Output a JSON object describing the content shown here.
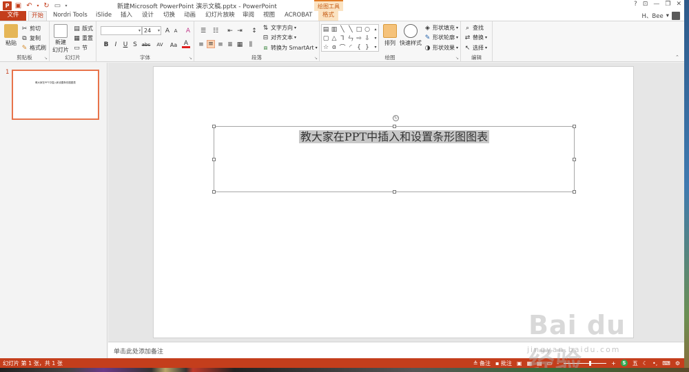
{
  "window": {
    "title": "新建Microsoft PowerPoint 演示文稿.pptx - PowerPoint",
    "contextual_group": "绘图工具",
    "help": "?",
    "minimize": "—",
    "restore": "❐",
    "close": "✕"
  },
  "qat": {
    "logo": "P"
  },
  "tabs": {
    "file": "文件",
    "items": [
      "开始",
      "Nordri Tools",
      "iSlide",
      "插入",
      "设计",
      "切换",
      "动画",
      "幻灯片放映",
      "审阅",
      "视图",
      "ACROBAT"
    ],
    "format": "格式",
    "active_index": 0
  },
  "user": {
    "name": "H、Bee",
    "dropdown": "▾"
  },
  "ribbon": {
    "clipboard": {
      "paste": "粘贴",
      "cut": "剪切",
      "copy": "复制",
      "format_painter": "格式刷",
      "label": "剪贴板"
    },
    "slides": {
      "new_slide": "新建",
      "new_slide2": "幻灯片",
      "layout": "版式",
      "reset": "重置",
      "section": "节",
      "label": "幻灯片"
    },
    "font": {
      "name": "",
      "size": "24",
      "grow": "A",
      "shrink": "A",
      "clear": "A",
      "bold": "B",
      "italic": "I",
      "underline": "U",
      "shadow": "S",
      "strike": "abc",
      "spacing": "AV",
      "case": "Aa",
      "color": "A",
      "label": "字体"
    },
    "paragraph": {
      "text_direction": "文字方向",
      "align_text": "对齐文本",
      "smartart": "转换为 SmartArt",
      "label": "段落"
    },
    "drawing": {
      "arrange": "排列",
      "quick_styles": "快速样式",
      "fill": "形状填充",
      "outline": "形状轮廓",
      "effects": "形状效果",
      "label": "绘图"
    },
    "editing": {
      "find": "查找",
      "replace": "替换",
      "select": "选择",
      "label": "编辑"
    }
  },
  "thumbnail": {
    "number": "1",
    "text": "教大家在PPT中插入和设置条形图图表"
  },
  "slide": {
    "title": "教大家在PPT中插入和设置条形图图表"
  },
  "notes": {
    "placeholder": "单击此处添加备注"
  },
  "status": {
    "slide_info": "幻灯片 第 1 张，共 1 张",
    "notes": "备注",
    "comments": "批注",
    "zoom_minus": "-",
    "zoom_plus": "+",
    "ime": "五"
  },
  "watermark": {
    "brand": "Bai du 经验",
    "url": "jingyan.baidu.com"
  },
  "colors": {
    "accent": "#c43e1c",
    "context": "#fbe3c2",
    "selection_border": "#e8734a"
  }
}
